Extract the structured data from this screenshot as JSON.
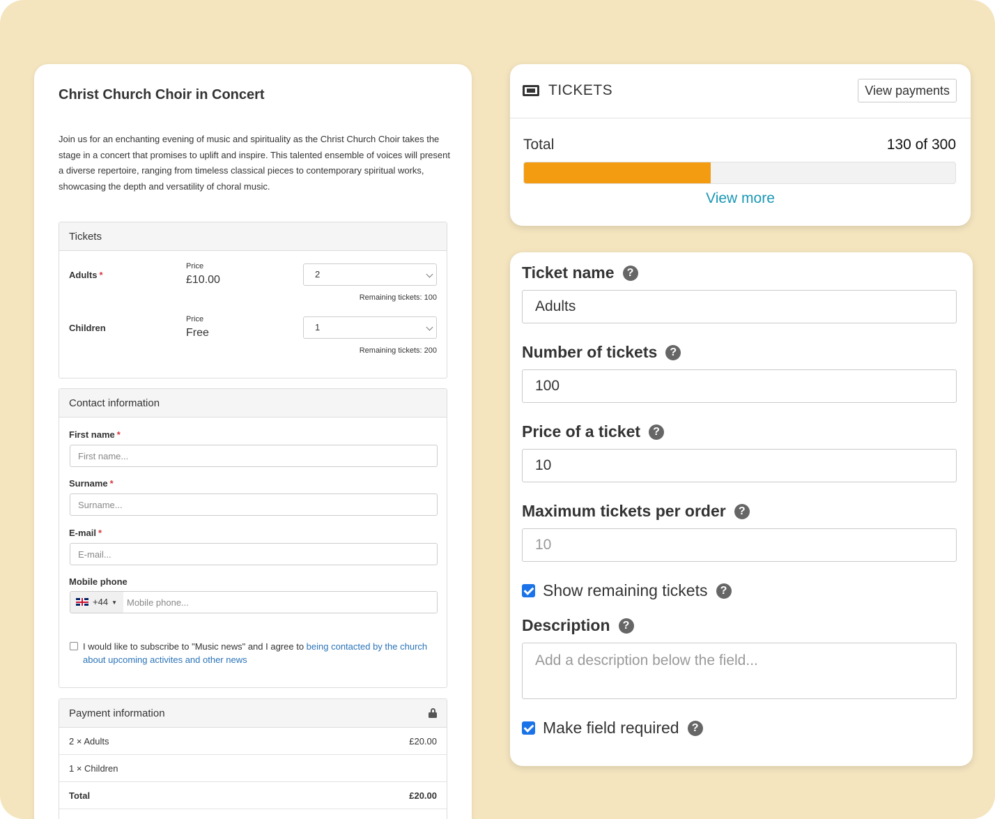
{
  "event": {
    "title": "Christ Church Choir in Concert",
    "description": "Join us for an enchanting evening of music and spirituality as the Christ Church Choir takes the stage in a concert that promises to uplift and inspire. This talented ensemble of voices will present a diverse repertoire, ranging from timeless classical pieces to contemporary spiritual works, showcasing the depth and versatility of choral music."
  },
  "tickets_panel": {
    "heading": "Tickets",
    "required_marker": "*",
    "rows": [
      {
        "name": "Adults",
        "price_label": "Price",
        "price": "£10.00",
        "quantity": "2",
        "remaining": "Remaining tickets: 100"
      },
      {
        "name": "Children",
        "price_label": "Price",
        "price": "Free",
        "quantity": "1",
        "remaining": "Remaining tickets: 200"
      }
    ]
  },
  "contact": {
    "heading": "Contact information",
    "first_name": {
      "label": "First name",
      "placeholder": "First name..."
    },
    "surname": {
      "label": "Surname",
      "placeholder": "Surname..."
    },
    "email": {
      "label": "E-mail",
      "placeholder": "E-mail..."
    },
    "mobile": {
      "label": "Mobile phone",
      "country_code": "+44",
      "placeholder": "Mobile phone..."
    },
    "consent": {
      "text": "I would like to subscribe to \"Music news\" and I agree to ",
      "link": "being contacted by the church about upcoming activites and other news"
    }
  },
  "payment": {
    "heading": "Payment information",
    "rows": [
      {
        "label": "2 × Adults",
        "amount": "£20.00"
      },
      {
        "label": "1 × Children",
        "amount": ""
      }
    ],
    "total": {
      "label": "Total",
      "amount": "£20.00"
    }
  },
  "summary": {
    "title": "TICKETS",
    "view_payments": "View payments",
    "total_label": "Total",
    "total_value": "130 of 300",
    "sold": 130,
    "capacity": 300,
    "progress_color": "#f39c12",
    "view_more": "View more"
  },
  "editor": {
    "ticket_name": {
      "label": "Ticket name",
      "value": "Adults"
    },
    "number_of_tickets": {
      "label": "Number of tickets",
      "value": "100"
    },
    "price": {
      "label": "Price of a ticket",
      "value": "10"
    },
    "max_per_order": {
      "label": "Maximum tickets per order",
      "placeholder": "10"
    },
    "show_remaining": {
      "label": "Show remaining tickets",
      "checked": true
    },
    "description": {
      "label": "Description",
      "placeholder": "Add a description below the field..."
    },
    "required": {
      "label": "Make field required",
      "checked": true
    },
    "help_glyph": "?"
  }
}
